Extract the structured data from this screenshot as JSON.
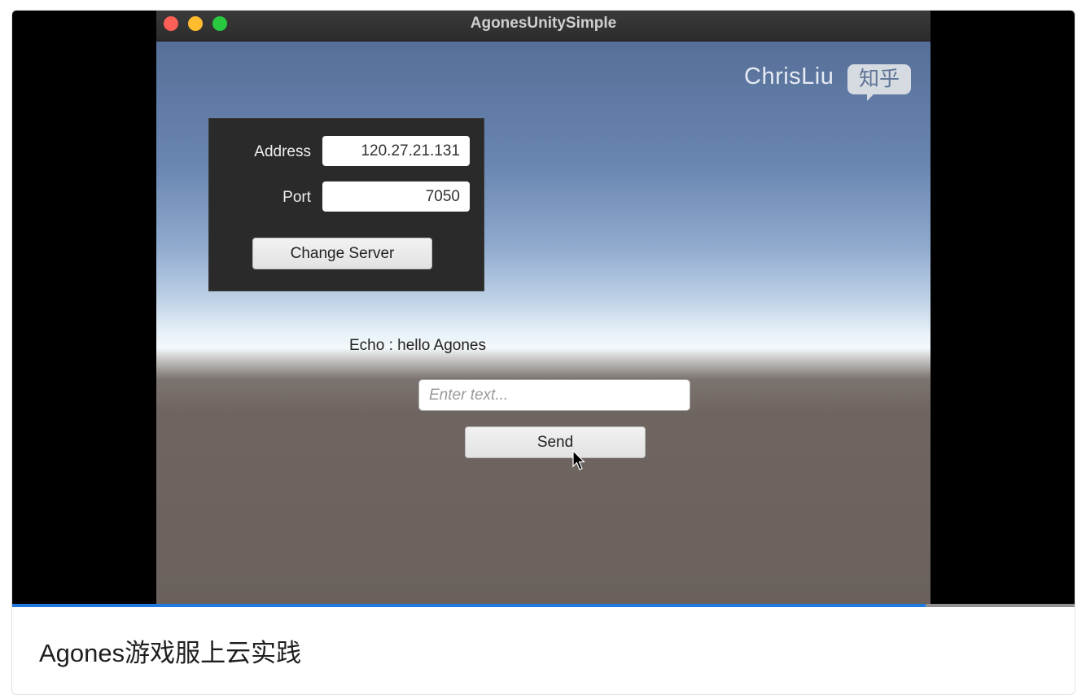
{
  "window": {
    "title": "AgonesUnitySimple"
  },
  "watermark": {
    "author": "ChrisLiu",
    "site": "知乎"
  },
  "server_panel": {
    "address_label": "Address",
    "address_value": "120.27.21.131",
    "port_label": "Port",
    "port_value": "7050",
    "change_button": "Change Server"
  },
  "echo": {
    "text": "Echo : hello Agones"
  },
  "message_input": {
    "placeholder": "Enter text..."
  },
  "send_button": {
    "label": "Send"
  },
  "video": {
    "progress": 0.86
  },
  "caption": {
    "title": "Agones游戏服上云实践"
  },
  "colors": {
    "progress": "#1f7ae0",
    "panel": "#2a2a2a"
  }
}
